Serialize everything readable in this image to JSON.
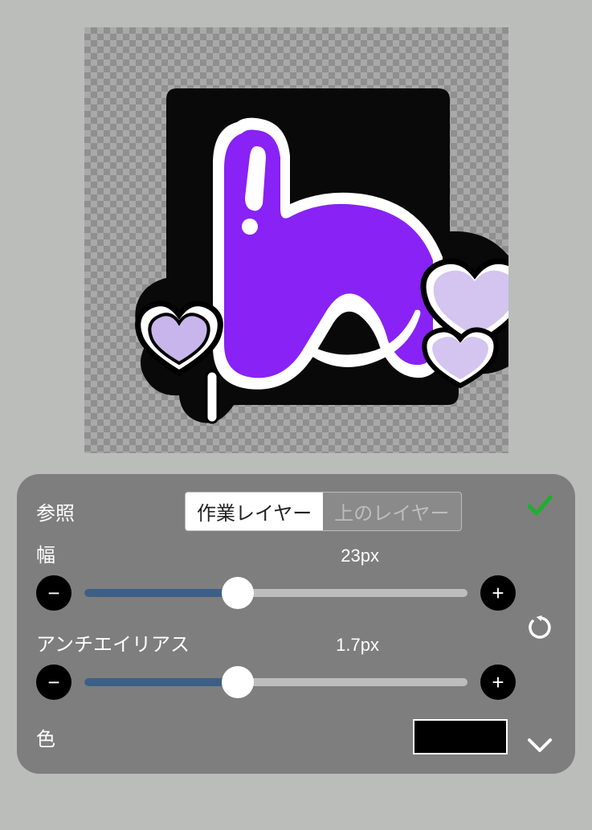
{
  "panel": {
    "reference_label": "参照",
    "segmented": {
      "working": "作業レイヤー",
      "above": "上のレイヤー"
    },
    "width": {
      "label": "幅",
      "value": "23px",
      "percent": 40
    },
    "antialias": {
      "label": "アンチエイリアス",
      "value": "1.7px",
      "percent": 40
    },
    "color": {
      "label": "色",
      "hex": "#000000"
    },
    "buttons": {
      "minus": "−",
      "plus": "+"
    }
  }
}
